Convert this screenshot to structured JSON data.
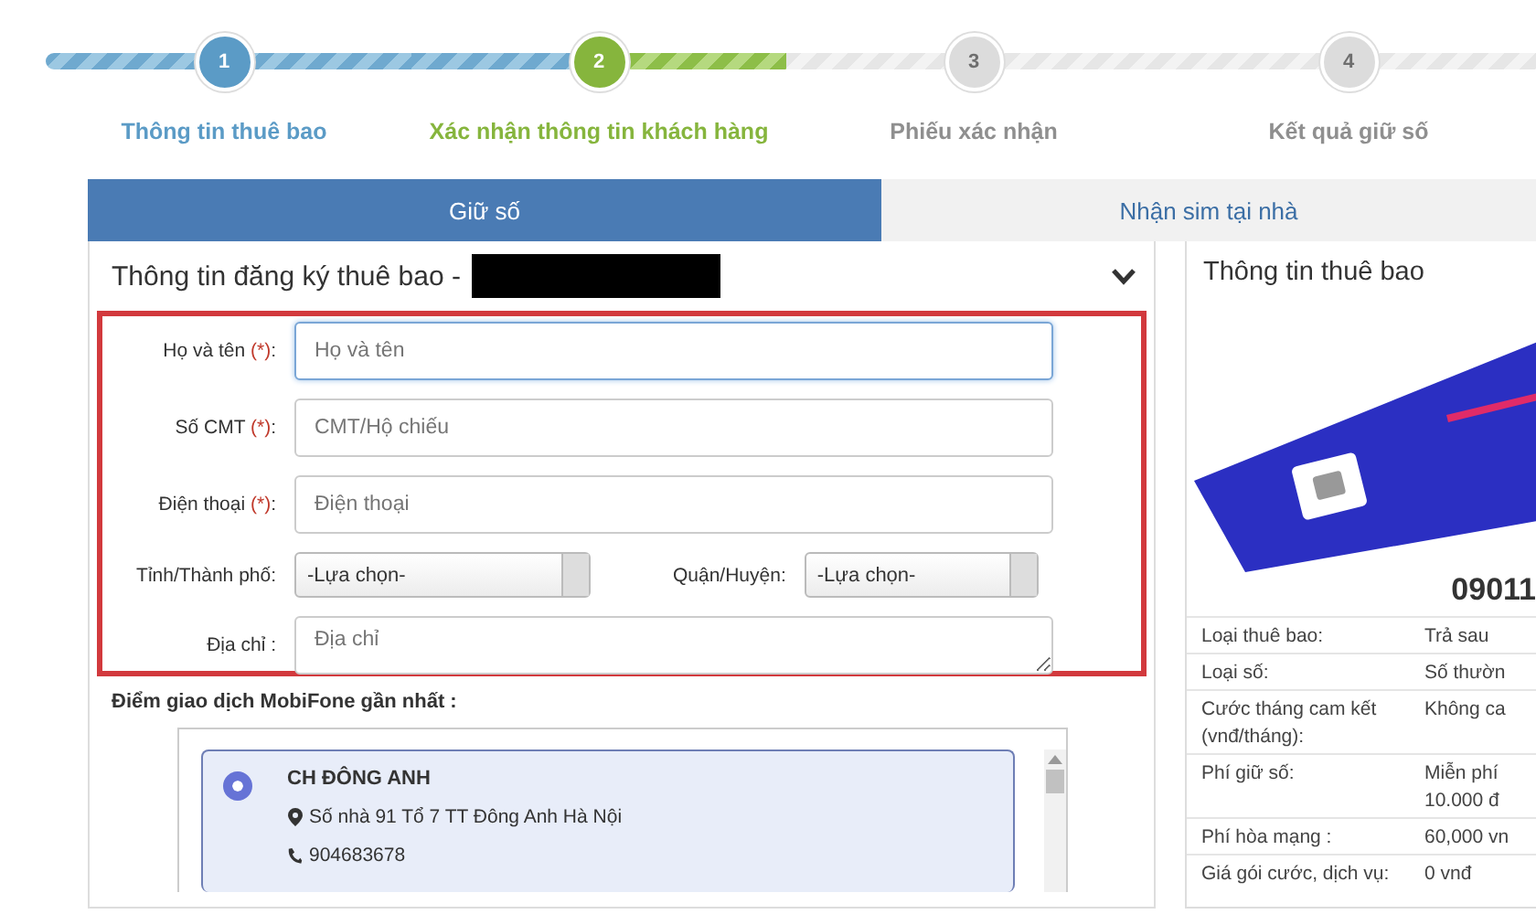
{
  "steps": [
    {
      "number": "1",
      "label": "Thông tin thuê bao",
      "completed": true,
      "current": false
    },
    {
      "number": "2",
      "label": "Xác nhận thông tin khách hàng",
      "completed": false,
      "current": true
    },
    {
      "number": "3",
      "label": "Phiếu xác nhận",
      "completed": false,
      "current": false
    },
    {
      "number": "4",
      "label": "Kết quả giữ số",
      "completed": false,
      "current": false
    }
  ],
  "tabs": [
    {
      "label": "Giữ số",
      "selected": true
    },
    {
      "label": "Nhận sim tại nhà",
      "selected": false
    }
  ],
  "form_panel": {
    "title": "Thông tin đăng ký thuê bao -",
    "redacted": true,
    "expanded": true,
    "fields": [
      {
        "kind": "text",
        "label": "Họ và tên",
        "required_mark": "(*)",
        "label_end": ":",
        "placeholder": "Họ và tên",
        "focused": true
      },
      {
        "kind": "text",
        "label": "Số CMT",
        "required_mark": "(*)",
        "label_end": ":",
        "placeholder": "CMT/Hộ chiếu",
        "focused": false
      },
      {
        "kind": "text",
        "label": "Điện thoại",
        "required_mark": "(*)",
        "label_end": ":",
        "placeholder": "Điện thoại",
        "focused": false
      },
      {
        "kind": "selects",
        "items": [
          {
            "label": "Tỉnh/Thành phố:",
            "value": "-Lựa chọn-"
          },
          {
            "label": "Quận/Huyện:",
            "value": "-Lựa chọn-"
          }
        ]
      },
      {
        "kind": "textarea",
        "label": "Địa chỉ :",
        "placeholder": "Địa chỉ"
      }
    ],
    "stores_label": "Điểm giao dịch MobiFone gần nhất :",
    "stores": [
      {
        "name": "CH ĐÔNG ANH",
        "address": "Số nhà 91 Tổ 7 TT Đông Anh Hà Nội",
        "phone": "904683678",
        "selected": true
      }
    ]
  },
  "info_panel": {
    "title": "Thông tin thuê bao",
    "number": "09011",
    "rows": [
      {
        "label": "Loại thuê bao:",
        "value": "Trả sau"
      },
      {
        "label": "Loại số:",
        "value": "Số thườn"
      },
      {
        "label": "Cước tháng cam kết (vnđ/tháng):",
        "value": "Không ca"
      },
      {
        "label": "Phí giữ số:",
        "value": "Miễn phí 10.000 đ"
      },
      {
        "label": "Phí hòa mạng :",
        "value": "60,000 vn"
      },
      {
        "label": "Giá gói cước, dịch vụ:",
        "value": "0 vnđ"
      }
    ]
  }
}
